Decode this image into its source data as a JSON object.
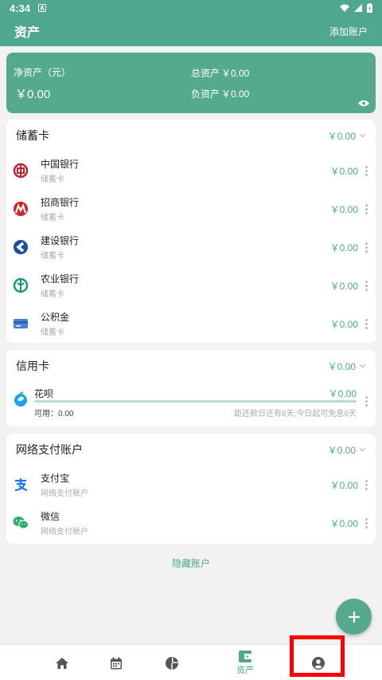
{
  "status": {
    "time": "4:34",
    "badge": "A"
  },
  "appbar": {
    "title": "资产",
    "add_label": "添加账户"
  },
  "summary": {
    "net_label": "净资产（元）",
    "net_value": "￥0.00",
    "total_label": "总资产",
    "total_value": "￥0.00",
    "debt_label": "负资产",
    "debt_value": "￥0.00"
  },
  "savings": {
    "title": "储蓄卡",
    "total": "￥0.00",
    "items": [
      {
        "name": "中国银行",
        "sub": "储蓄卡",
        "amount": "￥0.00",
        "icon": "boc-icon"
      },
      {
        "name": "招商银行",
        "sub": "储蓄卡",
        "amount": "￥0.00",
        "icon": "cmb-icon"
      },
      {
        "name": "建设银行",
        "sub": "储蓄卡",
        "amount": "￥0.00",
        "icon": "ccb-icon"
      },
      {
        "name": "农业银行",
        "sub": "储蓄卡",
        "amount": "￥0.00",
        "icon": "abc-icon"
      },
      {
        "name": "公积金",
        "sub": "储蓄卡",
        "amount": "￥0.00",
        "icon": "card-icon"
      }
    ]
  },
  "credit": {
    "title": "信用卡",
    "total": "￥0.00",
    "item": {
      "name": "花呗",
      "amount": "￥0.00",
      "available": "可用：0.00",
      "due_note": "距还款日还有6天,今日起可免息6天",
      "icon": "huabei-icon"
    }
  },
  "online": {
    "title": "网络支付账户",
    "total": "￥0.00",
    "items": [
      {
        "name": "支付宝",
        "sub": "网络支付账户",
        "amount": "￥0.00",
        "icon": "alipay-icon"
      },
      {
        "name": "微信",
        "sub": "网络支付账户",
        "amount": "￥0.00",
        "icon": "wechat-icon"
      }
    ]
  },
  "hidden_accounts": "隐藏账户",
  "nav": {
    "items": [
      {
        "icon": "home-icon",
        "label": ""
      },
      {
        "icon": "calendar-icon",
        "label": ""
      },
      {
        "icon": "pie-chart-icon",
        "label": ""
      },
      {
        "icon": "wallet-icon",
        "label": "资产",
        "active": true
      },
      {
        "icon": "account-icon",
        "label": ""
      }
    ]
  },
  "colors": {
    "primary": "#4fa88e",
    "highlight": "#ff0000"
  }
}
